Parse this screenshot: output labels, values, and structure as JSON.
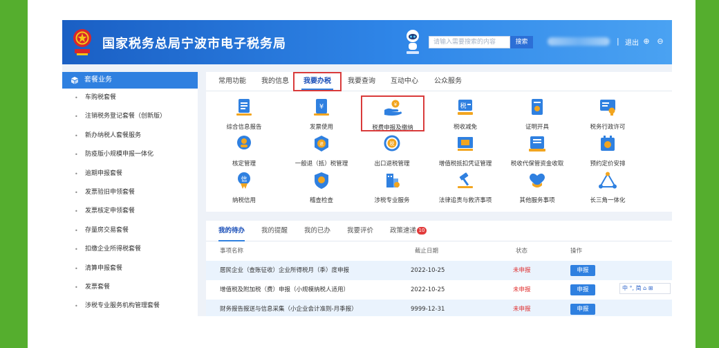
{
  "header": {
    "site_title": "国家税务总局宁波市电子税务局",
    "search_placeholder": "请输入需要搜索的内容",
    "search_button": "搜索",
    "separator": "|",
    "logout": "退出",
    "zoom_in_glyph": "⊕",
    "zoom_out_glyph": "⊖"
  },
  "sidebar": {
    "heading": "套餐业务",
    "items": [
      "车购税套餐",
      "注销税务登记套餐（创新版）",
      "新办纳税人套餐服务",
      "防疫版小规模申报一体化",
      "逾期申报套餐",
      "发票验旧申领套餐",
      "发票核定申领套餐",
      "存量房交易套餐",
      "扣缴企业所得税套餐",
      "清算申报套餐",
      "发票套餐",
      "涉税专业服务机构管理套餐"
    ]
  },
  "main_tabs": [
    "常用功能",
    "我的信息",
    "我要办税",
    "我要查询",
    "互动中心",
    "公众服务"
  ],
  "services": [
    {
      "label": "综合信息报告",
      "icon": "report-icon"
    },
    {
      "label": "发票使用",
      "icon": "invoice-icon"
    },
    {
      "label": "税费申报及缴纳",
      "icon": "hand-coin-icon"
    },
    {
      "label": "税收减免",
      "icon": "tax-relief-icon"
    },
    {
      "label": "证明开具",
      "icon": "certificate-icon"
    },
    {
      "label": "税务行政许可",
      "icon": "admin-license-icon"
    },
    {
      "label": "核定管理",
      "icon": "verify-icon"
    },
    {
      "label": "一般退（抵）税管理",
      "icon": "refund-icon"
    },
    {
      "label": "出口退税管理",
      "icon": "export-refund-icon"
    },
    {
      "label": "增值税抵扣凭证管理",
      "icon": "vat-voucher-icon"
    },
    {
      "label": "税收代保管资金收取",
      "icon": "custody-funds-icon"
    },
    {
      "label": "预约定价安排",
      "icon": "pricing-icon"
    },
    {
      "label": "纳税信用",
      "icon": "credit-icon"
    },
    {
      "label": "稽查检查",
      "icon": "inspection-icon"
    },
    {
      "label": "涉税专业服务",
      "icon": "professional-service-icon"
    },
    {
      "label": "法律追责与救济事项",
      "icon": "gavel-icon"
    },
    {
      "label": "其他服务事项",
      "icon": "heart-hand-icon"
    },
    {
      "label": "长三角一体化",
      "icon": "triangle-icon"
    }
  ],
  "todo": {
    "tabs": [
      "我的待办",
      "我的提醒",
      "我的已办",
      "我要评价",
      "政策速递"
    ],
    "policy_badge": "10",
    "columns": [
      "事项名称",
      "截止日期",
      "状态",
      "操作"
    ],
    "rows": [
      {
        "name": "居民企业（查账征收）企业所得税月（季）度申报",
        "deadline": "2022-10-25",
        "status": "未申报",
        "action": "申报"
      },
      {
        "name": "增值税及附加税（费）申报（小规模纳税人适用）",
        "deadline": "2022-10-25",
        "status": "未申报",
        "action": "申报"
      },
      {
        "name": "财务报告报送与信息采集（小企业会计准则-月季报）",
        "deadline": "9999-12-31",
        "status": "未申报",
        "action": "申报"
      }
    ]
  },
  "floating_toolbar": {
    "text": "中 °, 简 ⌂ ⊞"
  },
  "colors": {
    "brand_blue": "#2f80e0",
    "header_blue": "#1a5fc4",
    "highlight_red": "#d93a3a",
    "status_red": "#e02f2f",
    "frame_green": "#55ae2e"
  }
}
